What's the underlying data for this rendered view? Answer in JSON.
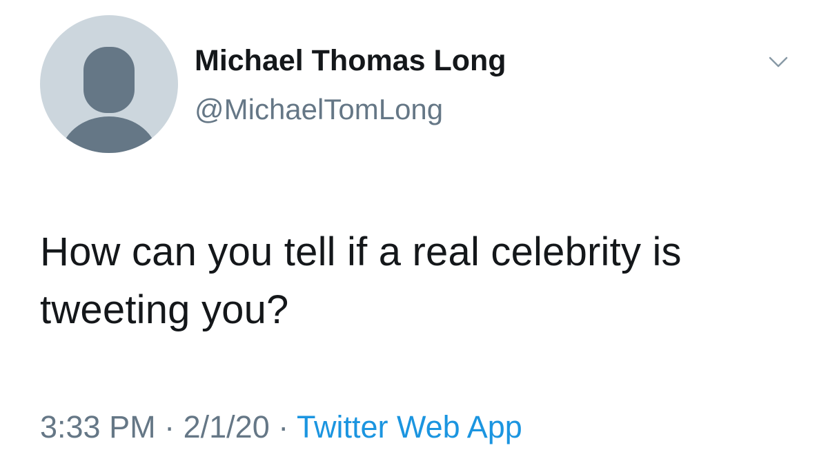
{
  "author": {
    "display_name": "Michael Thomas Long",
    "handle": "@MichaelTomLong",
    "avatar_icon": "default-profile-avatar-icon"
  },
  "menu": {
    "icon": "chevron-down-icon"
  },
  "tweet": {
    "text": "How can you tell if a real celebrity is tweeting you?"
  },
  "meta": {
    "time": "3:33 PM",
    "separator": "·",
    "date": "2/1/20",
    "source": "Twitter Web App"
  },
  "colors": {
    "text_primary": "#14171a",
    "text_secondary": "#657786",
    "link": "#1b95e0",
    "avatar_bg": "#ccd6dd",
    "avatar_figure": "#657786",
    "caret": "#8899a6"
  }
}
